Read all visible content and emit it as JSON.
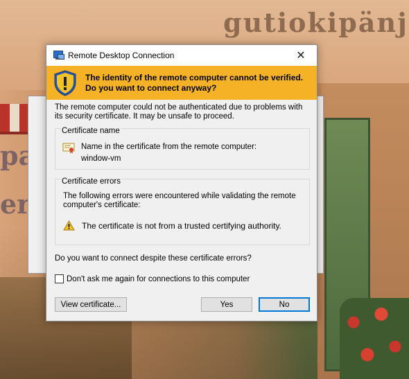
{
  "window": {
    "title": "Remote Desktop Connection",
    "close_glyph": "✕"
  },
  "banner": {
    "text": "The identity of the remote computer cannot be verified. Do you want to connect anyway?",
    "color": "#f5b227"
  },
  "description": "The remote computer could not be authenticated due to problems with its security certificate. It may be unsafe to proceed.",
  "certificate_name": {
    "group_label": "Certificate name",
    "line1": "Name in the certificate from the remote computer:",
    "line2": "window-vm"
  },
  "certificate_errors": {
    "group_label": "Certificate errors",
    "intro": "The following errors were encountered while validating the remote computer's certificate:",
    "error": "The certificate is not from a trusted certifying authority."
  },
  "question": "Do you want to connect despite these certificate errors?",
  "checkbox": {
    "label": "Don't ask me again for connections to this computer",
    "checked": false
  },
  "buttons": {
    "view_certificate": "View certificate...",
    "yes": "Yes",
    "no": "No"
  },
  "colors": {
    "accent_focus": "#0078d7",
    "warning": "#f5b227"
  }
}
